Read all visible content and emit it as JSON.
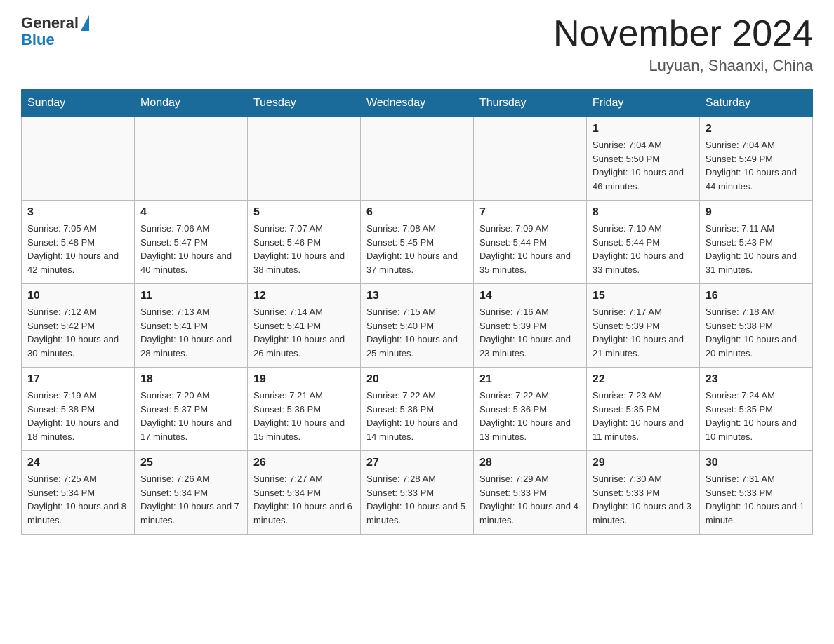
{
  "header": {
    "logo_general": "General",
    "logo_blue": "Blue",
    "month_year": "November 2024",
    "location": "Luyuan, Shaanxi, China"
  },
  "weekdays": [
    "Sunday",
    "Monday",
    "Tuesday",
    "Wednesday",
    "Thursday",
    "Friday",
    "Saturday"
  ],
  "weeks": [
    [
      {
        "day": "",
        "info": ""
      },
      {
        "day": "",
        "info": ""
      },
      {
        "day": "",
        "info": ""
      },
      {
        "day": "",
        "info": ""
      },
      {
        "day": "",
        "info": ""
      },
      {
        "day": "1",
        "info": "Sunrise: 7:04 AM\nSunset: 5:50 PM\nDaylight: 10 hours and 46 minutes."
      },
      {
        "day": "2",
        "info": "Sunrise: 7:04 AM\nSunset: 5:49 PM\nDaylight: 10 hours and 44 minutes."
      }
    ],
    [
      {
        "day": "3",
        "info": "Sunrise: 7:05 AM\nSunset: 5:48 PM\nDaylight: 10 hours and 42 minutes."
      },
      {
        "day": "4",
        "info": "Sunrise: 7:06 AM\nSunset: 5:47 PM\nDaylight: 10 hours and 40 minutes."
      },
      {
        "day": "5",
        "info": "Sunrise: 7:07 AM\nSunset: 5:46 PM\nDaylight: 10 hours and 38 minutes."
      },
      {
        "day": "6",
        "info": "Sunrise: 7:08 AM\nSunset: 5:45 PM\nDaylight: 10 hours and 37 minutes."
      },
      {
        "day": "7",
        "info": "Sunrise: 7:09 AM\nSunset: 5:44 PM\nDaylight: 10 hours and 35 minutes."
      },
      {
        "day": "8",
        "info": "Sunrise: 7:10 AM\nSunset: 5:44 PM\nDaylight: 10 hours and 33 minutes."
      },
      {
        "day": "9",
        "info": "Sunrise: 7:11 AM\nSunset: 5:43 PM\nDaylight: 10 hours and 31 minutes."
      }
    ],
    [
      {
        "day": "10",
        "info": "Sunrise: 7:12 AM\nSunset: 5:42 PM\nDaylight: 10 hours and 30 minutes."
      },
      {
        "day": "11",
        "info": "Sunrise: 7:13 AM\nSunset: 5:41 PM\nDaylight: 10 hours and 28 minutes."
      },
      {
        "day": "12",
        "info": "Sunrise: 7:14 AM\nSunset: 5:41 PM\nDaylight: 10 hours and 26 minutes."
      },
      {
        "day": "13",
        "info": "Sunrise: 7:15 AM\nSunset: 5:40 PM\nDaylight: 10 hours and 25 minutes."
      },
      {
        "day": "14",
        "info": "Sunrise: 7:16 AM\nSunset: 5:39 PM\nDaylight: 10 hours and 23 minutes."
      },
      {
        "day": "15",
        "info": "Sunrise: 7:17 AM\nSunset: 5:39 PM\nDaylight: 10 hours and 21 minutes."
      },
      {
        "day": "16",
        "info": "Sunrise: 7:18 AM\nSunset: 5:38 PM\nDaylight: 10 hours and 20 minutes."
      }
    ],
    [
      {
        "day": "17",
        "info": "Sunrise: 7:19 AM\nSunset: 5:38 PM\nDaylight: 10 hours and 18 minutes."
      },
      {
        "day": "18",
        "info": "Sunrise: 7:20 AM\nSunset: 5:37 PM\nDaylight: 10 hours and 17 minutes."
      },
      {
        "day": "19",
        "info": "Sunrise: 7:21 AM\nSunset: 5:36 PM\nDaylight: 10 hours and 15 minutes."
      },
      {
        "day": "20",
        "info": "Sunrise: 7:22 AM\nSunset: 5:36 PM\nDaylight: 10 hours and 14 minutes."
      },
      {
        "day": "21",
        "info": "Sunrise: 7:22 AM\nSunset: 5:36 PM\nDaylight: 10 hours and 13 minutes."
      },
      {
        "day": "22",
        "info": "Sunrise: 7:23 AM\nSunset: 5:35 PM\nDaylight: 10 hours and 11 minutes."
      },
      {
        "day": "23",
        "info": "Sunrise: 7:24 AM\nSunset: 5:35 PM\nDaylight: 10 hours and 10 minutes."
      }
    ],
    [
      {
        "day": "24",
        "info": "Sunrise: 7:25 AM\nSunset: 5:34 PM\nDaylight: 10 hours and 8 minutes."
      },
      {
        "day": "25",
        "info": "Sunrise: 7:26 AM\nSunset: 5:34 PM\nDaylight: 10 hours and 7 minutes."
      },
      {
        "day": "26",
        "info": "Sunrise: 7:27 AM\nSunset: 5:34 PM\nDaylight: 10 hours and 6 minutes."
      },
      {
        "day": "27",
        "info": "Sunrise: 7:28 AM\nSunset: 5:33 PM\nDaylight: 10 hours and 5 minutes."
      },
      {
        "day": "28",
        "info": "Sunrise: 7:29 AM\nSunset: 5:33 PM\nDaylight: 10 hours and 4 minutes."
      },
      {
        "day": "29",
        "info": "Sunrise: 7:30 AM\nSunset: 5:33 PM\nDaylight: 10 hours and 3 minutes."
      },
      {
        "day": "30",
        "info": "Sunrise: 7:31 AM\nSunset: 5:33 PM\nDaylight: 10 hours and 1 minute."
      }
    ]
  ]
}
